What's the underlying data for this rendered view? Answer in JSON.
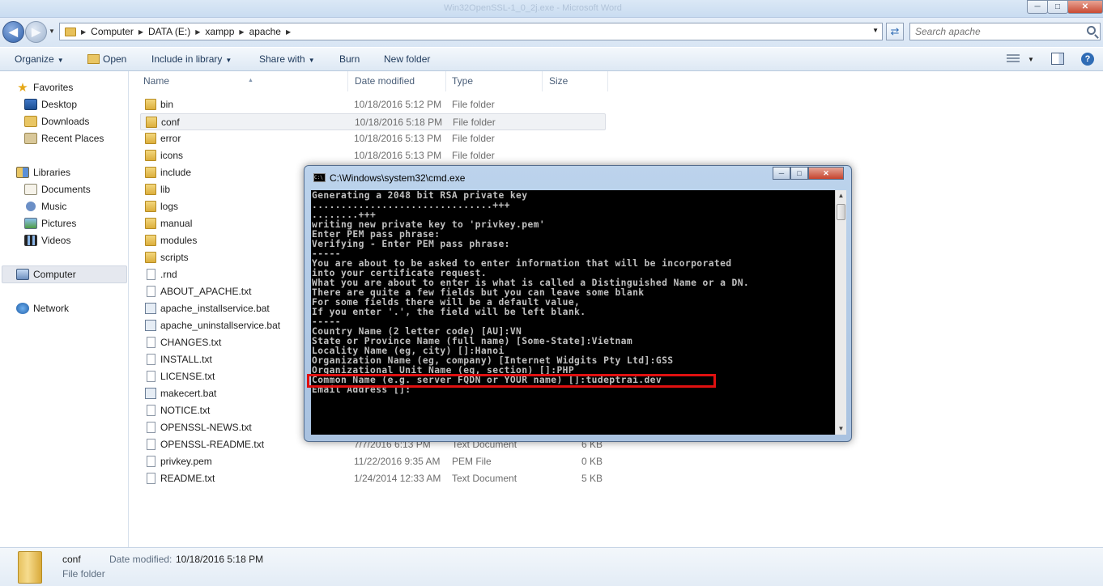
{
  "window": {
    "ghost_title": "Win32OpenSSL-1_0_2j.exe - Microsoft Word",
    "min": "─",
    "max": "□",
    "close": "✕"
  },
  "address": {
    "back": "◀",
    "forward": "▶",
    "breadcrumbs": [
      "Computer",
      "DATA (E:)",
      "xampp",
      "apache"
    ],
    "search_placeholder": "Search apache"
  },
  "toolbar": {
    "organize": "Organize",
    "open": "Open",
    "include_in_library": "Include in library",
    "share_with": "Share with",
    "burn": "Burn",
    "new_folder": "New folder"
  },
  "nav": {
    "favorites": "Favorites",
    "desktop": "Desktop",
    "downloads": "Downloads",
    "recent_places": "Recent Places",
    "libraries": "Libraries",
    "documents": "Documents",
    "music": "Music",
    "pictures": "Pictures",
    "videos": "Videos",
    "computer": "Computer",
    "network": "Network"
  },
  "columns": {
    "name": "Name",
    "date_modified": "Date modified",
    "type": "Type",
    "size": "Size"
  },
  "files": [
    {
      "name": "bin",
      "date": "10/18/2016 5:12 PM",
      "type": "File folder",
      "size": "",
      "kind": "folder"
    },
    {
      "name": "conf",
      "date": "10/18/2016 5:18 PM",
      "type": "File folder",
      "size": "",
      "kind": "folder",
      "selected": true
    },
    {
      "name": "error",
      "date": "10/18/2016 5:13 PM",
      "type": "File folder",
      "size": "",
      "kind": "folder"
    },
    {
      "name": "icons",
      "date": "10/18/2016 5:13 PM",
      "type": "File folder",
      "size": "",
      "kind": "folder"
    },
    {
      "name": "include",
      "date": "",
      "type": "",
      "size": "",
      "kind": "folder"
    },
    {
      "name": "lib",
      "date": "",
      "type": "",
      "size": "",
      "kind": "folder"
    },
    {
      "name": "logs",
      "date": "",
      "type": "",
      "size": "",
      "kind": "folder"
    },
    {
      "name": "manual",
      "date": "",
      "type": "",
      "size": "",
      "kind": "folder"
    },
    {
      "name": "modules",
      "date": "",
      "type": "",
      "size": "",
      "kind": "folder"
    },
    {
      "name": "scripts",
      "date": "",
      "type": "",
      "size": "",
      "kind": "folder"
    },
    {
      "name": ".rnd",
      "date": "",
      "type": "",
      "size": "",
      "kind": "file"
    },
    {
      "name": "ABOUT_APACHE.txt",
      "date": "",
      "type": "",
      "size": "",
      "kind": "file"
    },
    {
      "name": "apache_installservice.bat",
      "date": "",
      "type": "",
      "size": "",
      "kind": "bat"
    },
    {
      "name": "apache_uninstallservice.bat",
      "date": "",
      "type": "",
      "size": "",
      "kind": "bat"
    },
    {
      "name": "CHANGES.txt",
      "date": "",
      "type": "",
      "size": "",
      "kind": "file"
    },
    {
      "name": "INSTALL.txt",
      "date": "",
      "type": "",
      "size": "",
      "kind": "file"
    },
    {
      "name": "LICENSE.txt",
      "date": "",
      "type": "",
      "size": "",
      "kind": "file"
    },
    {
      "name": "makecert.bat",
      "date": "",
      "type": "",
      "size": "",
      "kind": "bat"
    },
    {
      "name": "NOTICE.txt",
      "date": "",
      "type": "",
      "size": "",
      "kind": "file"
    },
    {
      "name": "OPENSSL-NEWS.txt",
      "date": "",
      "type": "",
      "size": "",
      "kind": "file"
    },
    {
      "name": "OPENSSL-README.txt",
      "date": "7/7/2016 6:13 PM",
      "type": "Text Document",
      "size": "6 KB",
      "kind": "file"
    },
    {
      "name": "privkey.pem",
      "date": "11/22/2016 9:35 AM",
      "type": "PEM File",
      "size": "0 KB",
      "kind": "file"
    },
    {
      "name": "README.txt",
      "date": "1/24/2014 12:33 AM",
      "type": "Text Document",
      "size": "5 KB",
      "kind": "file"
    }
  ],
  "details": {
    "name": "conf",
    "date_label": "Date modified:",
    "date_value": "10/18/2016 5:18 PM",
    "type": "File folder"
  },
  "cmd": {
    "title": "C:\\Windows\\system32\\cmd.exe",
    "icon_text": "C:\\",
    "lines": [
      "Generating a 2048 bit RSA private key",
      "...............................+++",
      "........+++",
      "writing new private key to 'privkey.pem'",
      "Enter PEM pass phrase:",
      "Verifying - Enter PEM pass phrase:",
      "-----",
      "You are about to be asked to enter information that will be incorporated",
      "into your certificate request.",
      "What you are about to enter is what is called a Distinguished Name or a DN.",
      "There are quite a few fields but you can leave some blank",
      "For some fields there will be a default value,",
      "If you enter '.', the field will be left blank.",
      "-----",
      "Country Name (2 letter code) [AU]:VN",
      "State or Province Name (full name) [Some-State]:Vietnam",
      "Locality Name (eg, city) []:Hanoi",
      "Organization Name (eg, company) [Internet Widgits Pty Ltd]:GSS",
      "Organizational Unit Name (eg, section) []:PHP",
      "Common Name (e.g. server FQDN or YOUR name) []:tudeptrai.dev",
      "Email Address []:"
    ]
  },
  "colors": {
    "highlight": "#e01010",
    "console_bg": "#000000",
    "console_fg": "#c0c0c0"
  }
}
